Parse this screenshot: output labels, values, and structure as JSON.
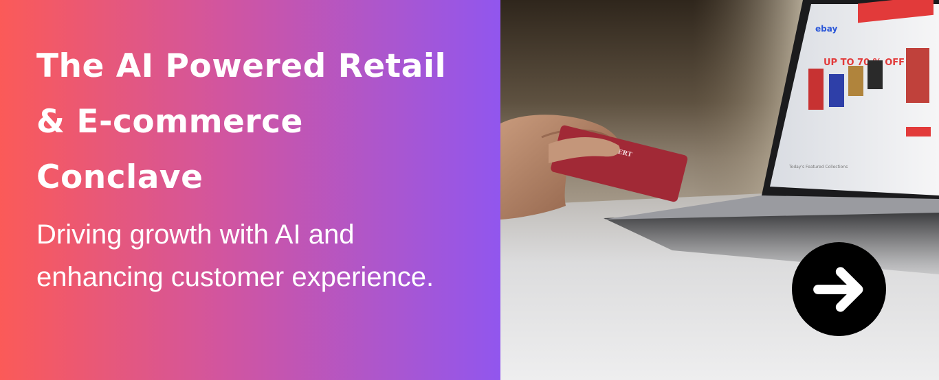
{
  "headline": "The AI Powered Retail & E-commerce Conclave",
  "subline": "Driving growth with AI and enhancing customer experience.",
  "photo": {
    "screen_banner": "UP TO 70 % OFF",
    "screen_logo": "ebay",
    "screen_section": "Today's Featured Collections",
    "card_brand": "HUBERT"
  },
  "cta": {
    "icon": "arrow-right-icon"
  },
  "colors": {
    "gradient_start": "#fb5a58",
    "gradient_mid": "#d155a0",
    "gradient_end": "#9156ee",
    "cta_background": "#000000",
    "text": "#ffffff"
  }
}
